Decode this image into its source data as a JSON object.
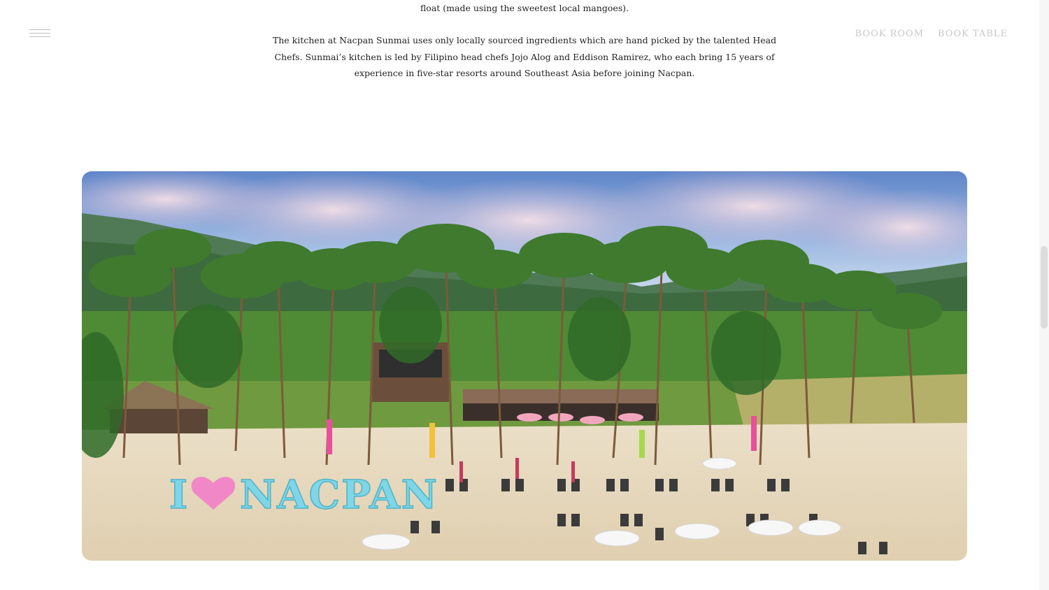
{
  "header": {
    "nav": [
      {
        "label": "BOOK ROOM"
      },
      {
        "label": "BOOK TABLE"
      }
    ]
  },
  "content": {
    "line_top": "float (made using the sweetest local mangoes).",
    "paragraph": "The kitchen at Nacpan Sunmai uses only locally sourced ingredients which are hand picked by the talented Head Chefs. Sunmai’s kitchen is led by Filipino head chefs Jojo Alog and Eddison Ramirez, who each bring 15 years of experience in five-star resorts around Southeast Asia before joining Nacpan."
  },
  "hero": {
    "sign_text": "I ♥ NACPAN",
    "colors": {
      "sky": "#8fb3e0",
      "sand": "#e8dcc4",
      "sign": "#7fd6e6",
      "heart": "#f287c7",
      "palm": "#3f7a2e"
    }
  }
}
